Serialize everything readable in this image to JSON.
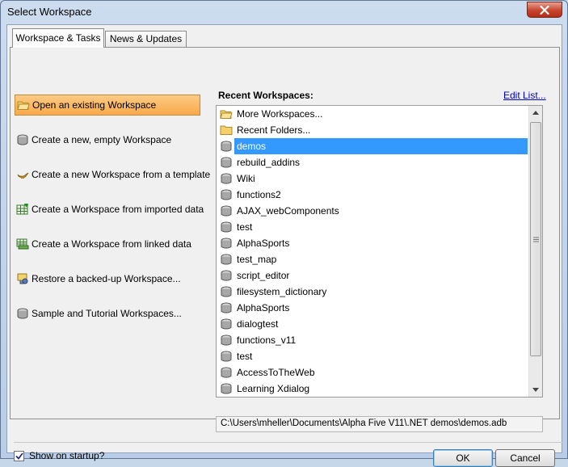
{
  "window": {
    "title": "Select Workspace"
  },
  "tabs": [
    {
      "label": "Workspace & Tasks",
      "active": true
    },
    {
      "label": "News & Updates",
      "active": false
    }
  ],
  "actions": [
    {
      "label": "Open an existing Workspace",
      "icon": "open-folder-icon",
      "selected": true
    },
    {
      "label": "Create a new, empty Workspace",
      "icon": "database-icon",
      "selected": false
    },
    {
      "label": "Create a new Workspace from a template",
      "icon": "magic-lamp-icon",
      "selected": false
    },
    {
      "label": "Create a Workspace from imported data",
      "icon": "import-table-icon",
      "selected": false
    },
    {
      "label": "Create a Workspace from linked data",
      "icon": "linked-table-icon",
      "selected": false
    },
    {
      "label": "Restore a backed-up Workspace...",
      "icon": "restore-icon",
      "selected": false
    },
    {
      "label": "Sample and Tutorial Workspaces...",
      "icon": "database-icon",
      "selected": false
    }
  ],
  "recent": {
    "header": "Recent Workspaces:",
    "edit_link": "Edit List...",
    "items": [
      {
        "label": "More Workspaces...",
        "icon": "open-folder-icon"
      },
      {
        "label": "Recent Folders...",
        "icon": "folder-icon"
      },
      {
        "label": "demos",
        "icon": "database-icon",
        "selected": true
      },
      {
        "label": "rebuild_addins",
        "icon": "database-icon"
      },
      {
        "label": "Wiki",
        "icon": "database-icon"
      },
      {
        "label": "functions2",
        "icon": "database-icon"
      },
      {
        "label": "AJAX_webComponents",
        "icon": "database-icon"
      },
      {
        "label": "test",
        "icon": "database-icon"
      },
      {
        "label": "AlphaSports",
        "icon": "database-icon"
      },
      {
        "label": "test_map",
        "icon": "database-icon"
      },
      {
        "label": "script_editor",
        "icon": "database-icon"
      },
      {
        "label": "filesystem_dictionary",
        "icon": "database-icon"
      },
      {
        "label": "AlphaSports",
        "icon": "database-icon"
      },
      {
        "label": "dialogtest",
        "icon": "database-icon"
      },
      {
        "label": "functions_v11",
        "icon": "database-icon"
      },
      {
        "label": "test",
        "icon": "database-icon"
      },
      {
        "label": "AccessToTheWeb",
        "icon": "database-icon"
      },
      {
        "label": "Learning Xdialog",
        "icon": "database-icon"
      }
    ],
    "path": "C:\\Users\\mheller\\Documents\\Alpha Five V11\\.NET demos\\demos.adb"
  },
  "footer": {
    "show_on_startup_label": "Show on startup?",
    "show_on_startup_checked": true,
    "ok_label": "OK",
    "cancel_label": "Cancel"
  },
  "colors": {
    "selection": "#3399ff",
    "selected_action": "#f9a94b",
    "link": "#0000cc"
  }
}
